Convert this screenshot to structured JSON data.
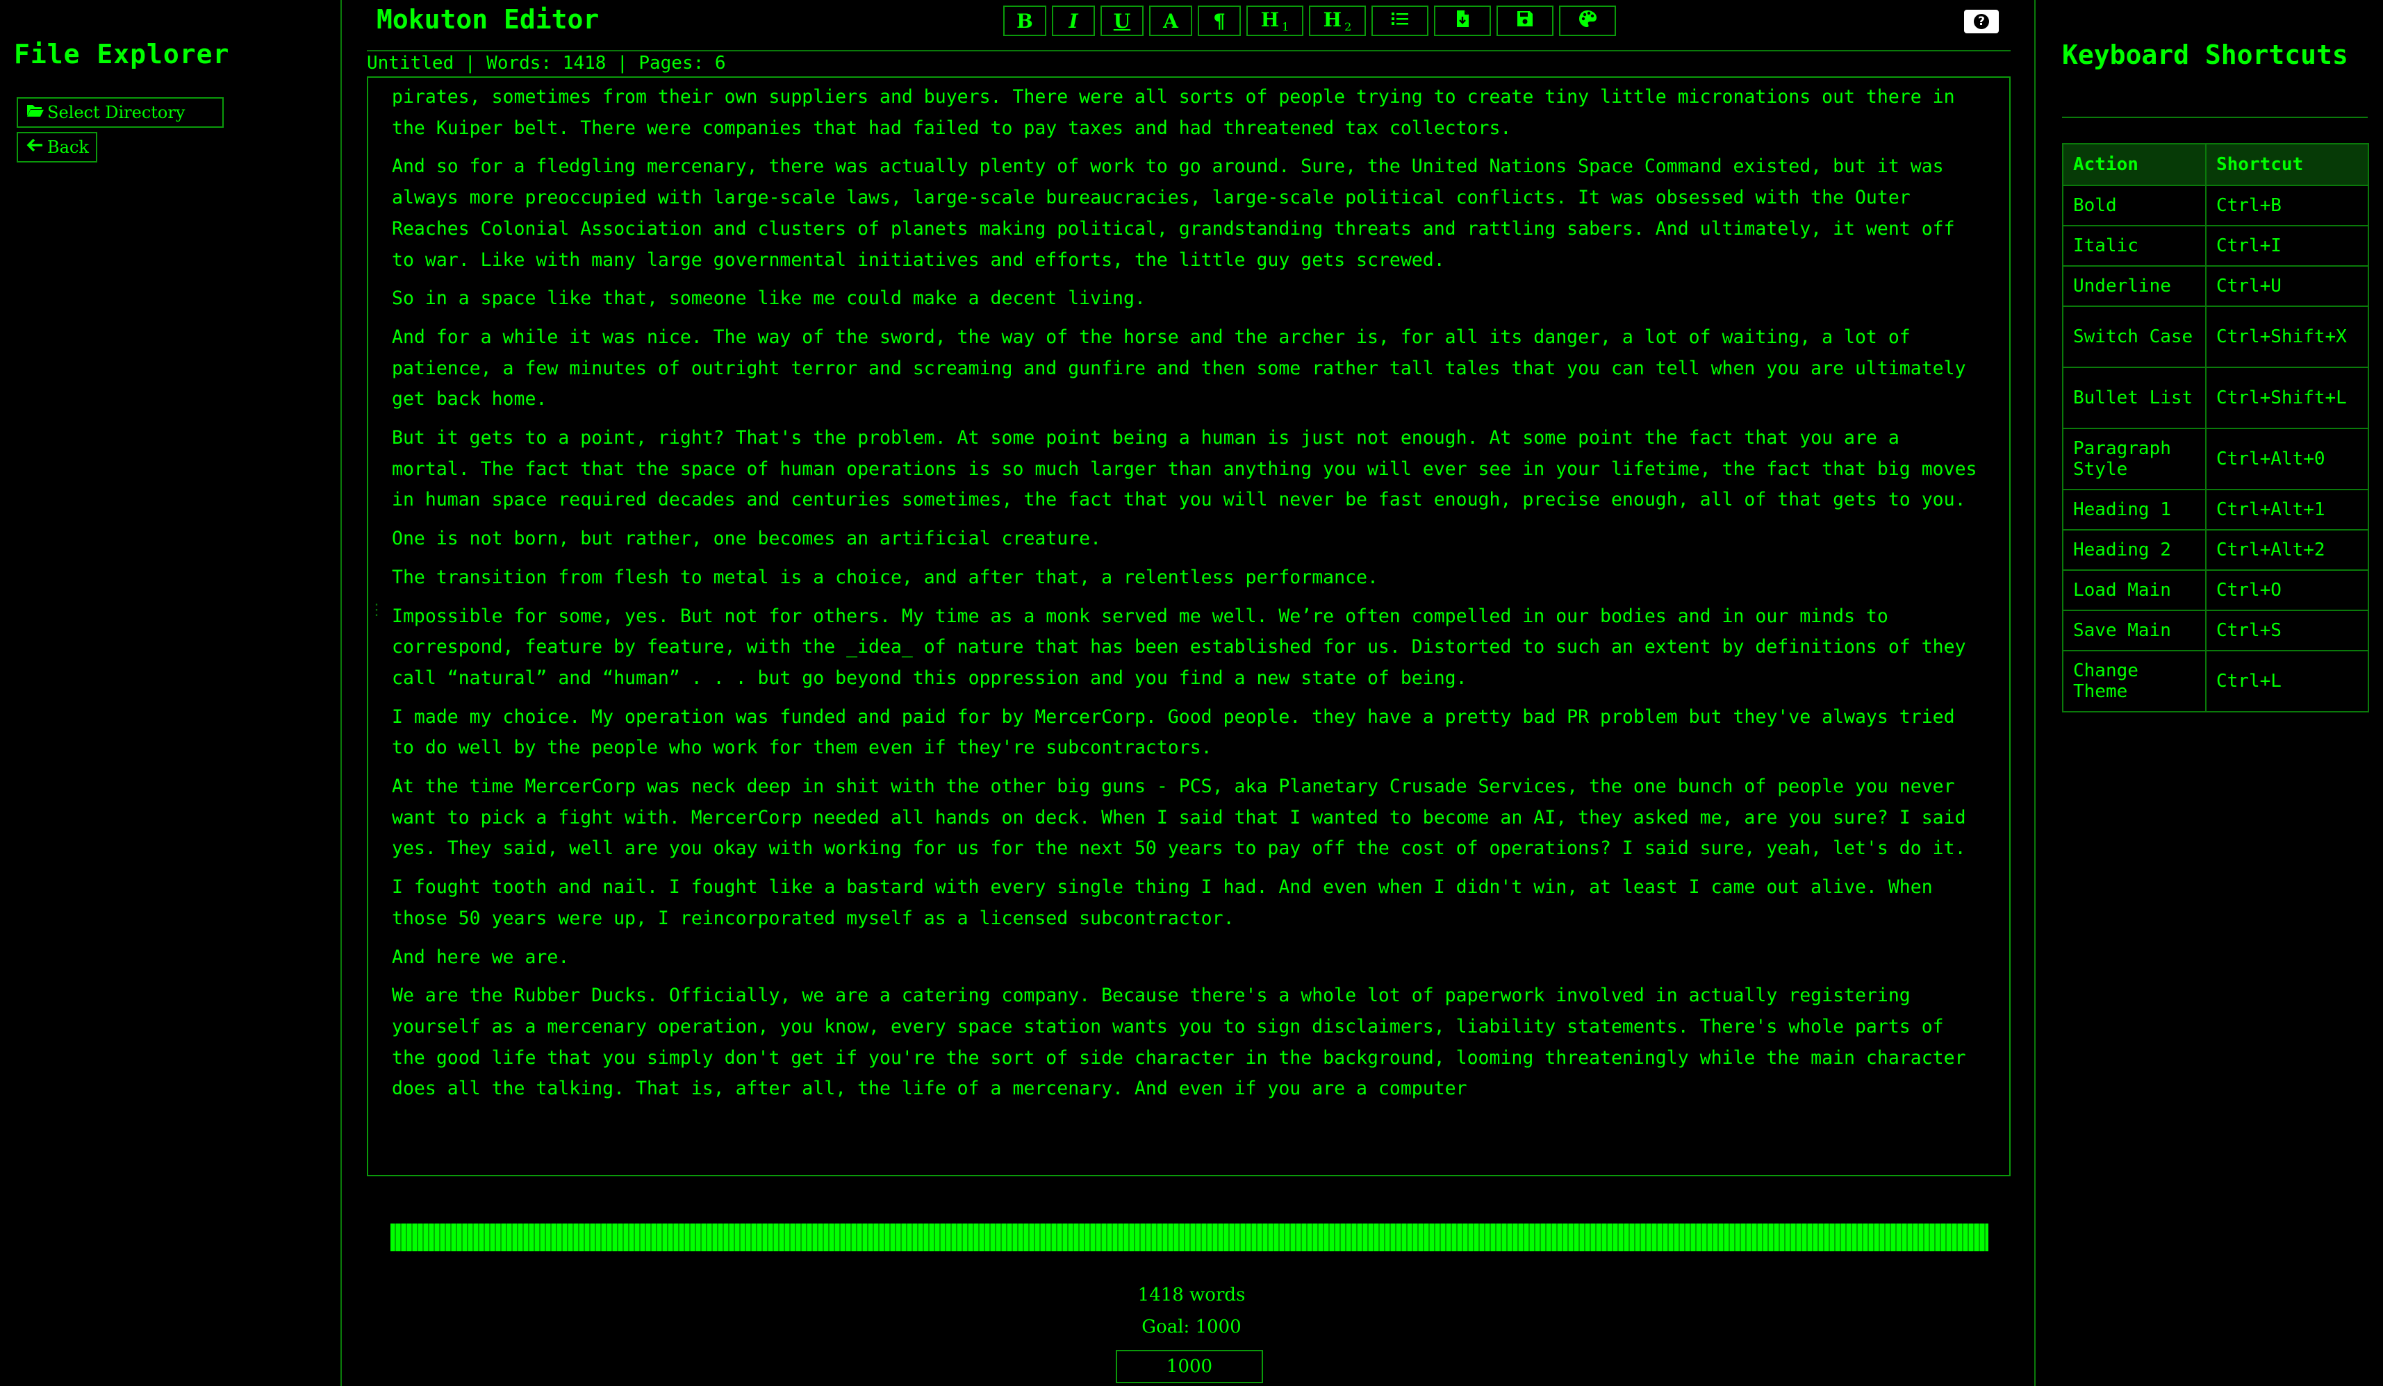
{
  "left_panel": {
    "title": "File Explorer",
    "select_directory_label": "Select Directory",
    "back_label": "Back"
  },
  "app": {
    "title": "Mokuton Editor"
  },
  "toolbar": {
    "bold": "B",
    "italic": "I",
    "underline": "U",
    "switch_case": "A",
    "paragraph": "¶",
    "h1": "H",
    "h1_sub": "1",
    "h2": "H",
    "h2_sub": "2",
    "help": "?"
  },
  "status": {
    "line": "Untitled | Words: 1418 | Pages: 6"
  },
  "editor": {
    "paragraphs": [
      "pirates, sometimes from their own suppliers and buyers. There were all sorts of people trying to create tiny little micronations out there in the Kuiper belt. There were companies that had failed to pay taxes and had threatened tax collectors.",
      "And so for a fledgling mercenary, there was actually plenty of work to go around. Sure, the United Nations Space Command existed, but it was always more preoccupied with large-scale laws, large-scale bureaucracies, large-scale political conflicts. It was obsessed with the Outer Reaches Colonial Association and clusters of planets making political, grandstanding threats and rattling sabers. And ultimately, it went off to war. Like with many large governmental initiatives and efforts, the little guy gets screwed.",
      "So in a space like that, someone like me could make a decent living.",
      "And for a while it was nice. The way of the sword, the way of the horse and the archer is, for all its danger, a lot of waiting, a lot of patience, a few minutes of outright terror and screaming and gunfire and then some rather tall tales that you can tell when you are ultimately get back home.",
      "But it gets to a point, right? That's the problem. At some point being a human is just not enough. At some point the fact that you are a mortal. The fact that the space of human operations is so much larger than anything you will ever see in your lifetime, the fact that big moves in human space required decades and centuries sometimes, the fact that you will never be fast enough, precise enough, all of that gets to you.",
      "One is not born, but rather, one becomes an artificial creature.",
      "The transition from flesh to metal is a choice, and after that, a relentless performance.",
      "Impossible for some, yes. But not for others. My time as a monk served me well. We’re often compelled in our bodies and in our minds to correspond, feature by feature, with the _idea_ of nature that has been established for us. Distorted to such an extent by definitions of they call “natural” and “human” . . . but go beyond this oppression and you find a new state of being.",
      "I made my choice. My operation was funded and paid for by MercerCorp. Good people. they have a pretty bad PR problem but they've always tried to do well by the people who work for them even if they're subcontractors.",
      "At the time MercerCorp was neck deep in shit with the other big guns - PCS, aka Planetary Crusade Services, the one bunch of people you never want to pick a fight with. MercerCorp needed all hands on deck. When I said that I wanted to become an AI, they asked me, are you sure? I said yes. They said, well are you okay with working for us for the next 50 years to pay off the cost of operations? I said sure, yeah, let's do it.",
      "I fought tooth and nail. I fought like a bastard with every single thing I had. And even when I didn't win, at least I came out alive. When those 50 years were up, I reincorporated myself as a licensed subcontractor.",
      "And here we are.",
      "We are the Rubber Ducks. Officially, we are a catering company. Because there's a whole lot of paperwork involved in actually registering yourself as a mercenary operation, you know, every space station wants you to sign disclaimers, liability statements. There's whole parts of the good life that you simply don't get if you're the sort of side character in the background, looming threateningly while the main character does all the talking. That is, after all, the life of a mercenary. And even if you are a computer"
    ]
  },
  "goal": {
    "progress_fraction": 1.0,
    "word_count_text": "1418 words",
    "goal_label": "Goal: 1000",
    "goal_value": "1000"
  },
  "right_panel": {
    "title": "Keyboard Shortcuts",
    "columns": [
      "Action",
      "Shortcut"
    ],
    "rows": [
      {
        "action": "Bold",
        "shortcut": "Ctrl+B"
      },
      {
        "action": "Italic",
        "shortcut": "Ctrl+I"
      },
      {
        "action": "Underline",
        "shortcut": "Ctrl+U"
      },
      {
        "action": "Switch Case",
        "shortcut": "Ctrl+Shift+X"
      },
      {
        "action": "Bullet List",
        "shortcut": "Ctrl+Shift+L"
      },
      {
        "action": "Paragraph Style",
        "shortcut": "Ctrl+Alt+0"
      },
      {
        "action": "Heading 1",
        "shortcut": "Ctrl+Alt+1"
      },
      {
        "action": "Heading 2",
        "shortcut": "Ctrl+Alt+2"
      },
      {
        "action": "Load Main",
        "shortcut": "Ctrl+O"
      },
      {
        "action": "Save Main",
        "shortcut": "Ctrl+S"
      },
      {
        "action": "Change Theme",
        "shortcut": "Ctrl+L"
      }
    ]
  },
  "colors": {
    "accent": "#00ff00",
    "background": "#000000",
    "border": "#0a9a0a",
    "table_header_bg": "#063a06",
    "scrollbar": "#c8c8c8"
  },
  "icons": {
    "select_directory": "folder-open-icon",
    "back": "arrow-left-icon",
    "bullet_list": "list-icon",
    "load": "file-icon",
    "save": "floppy-disk-icon",
    "theme": "palette-icon",
    "help": "question-circle-icon"
  }
}
